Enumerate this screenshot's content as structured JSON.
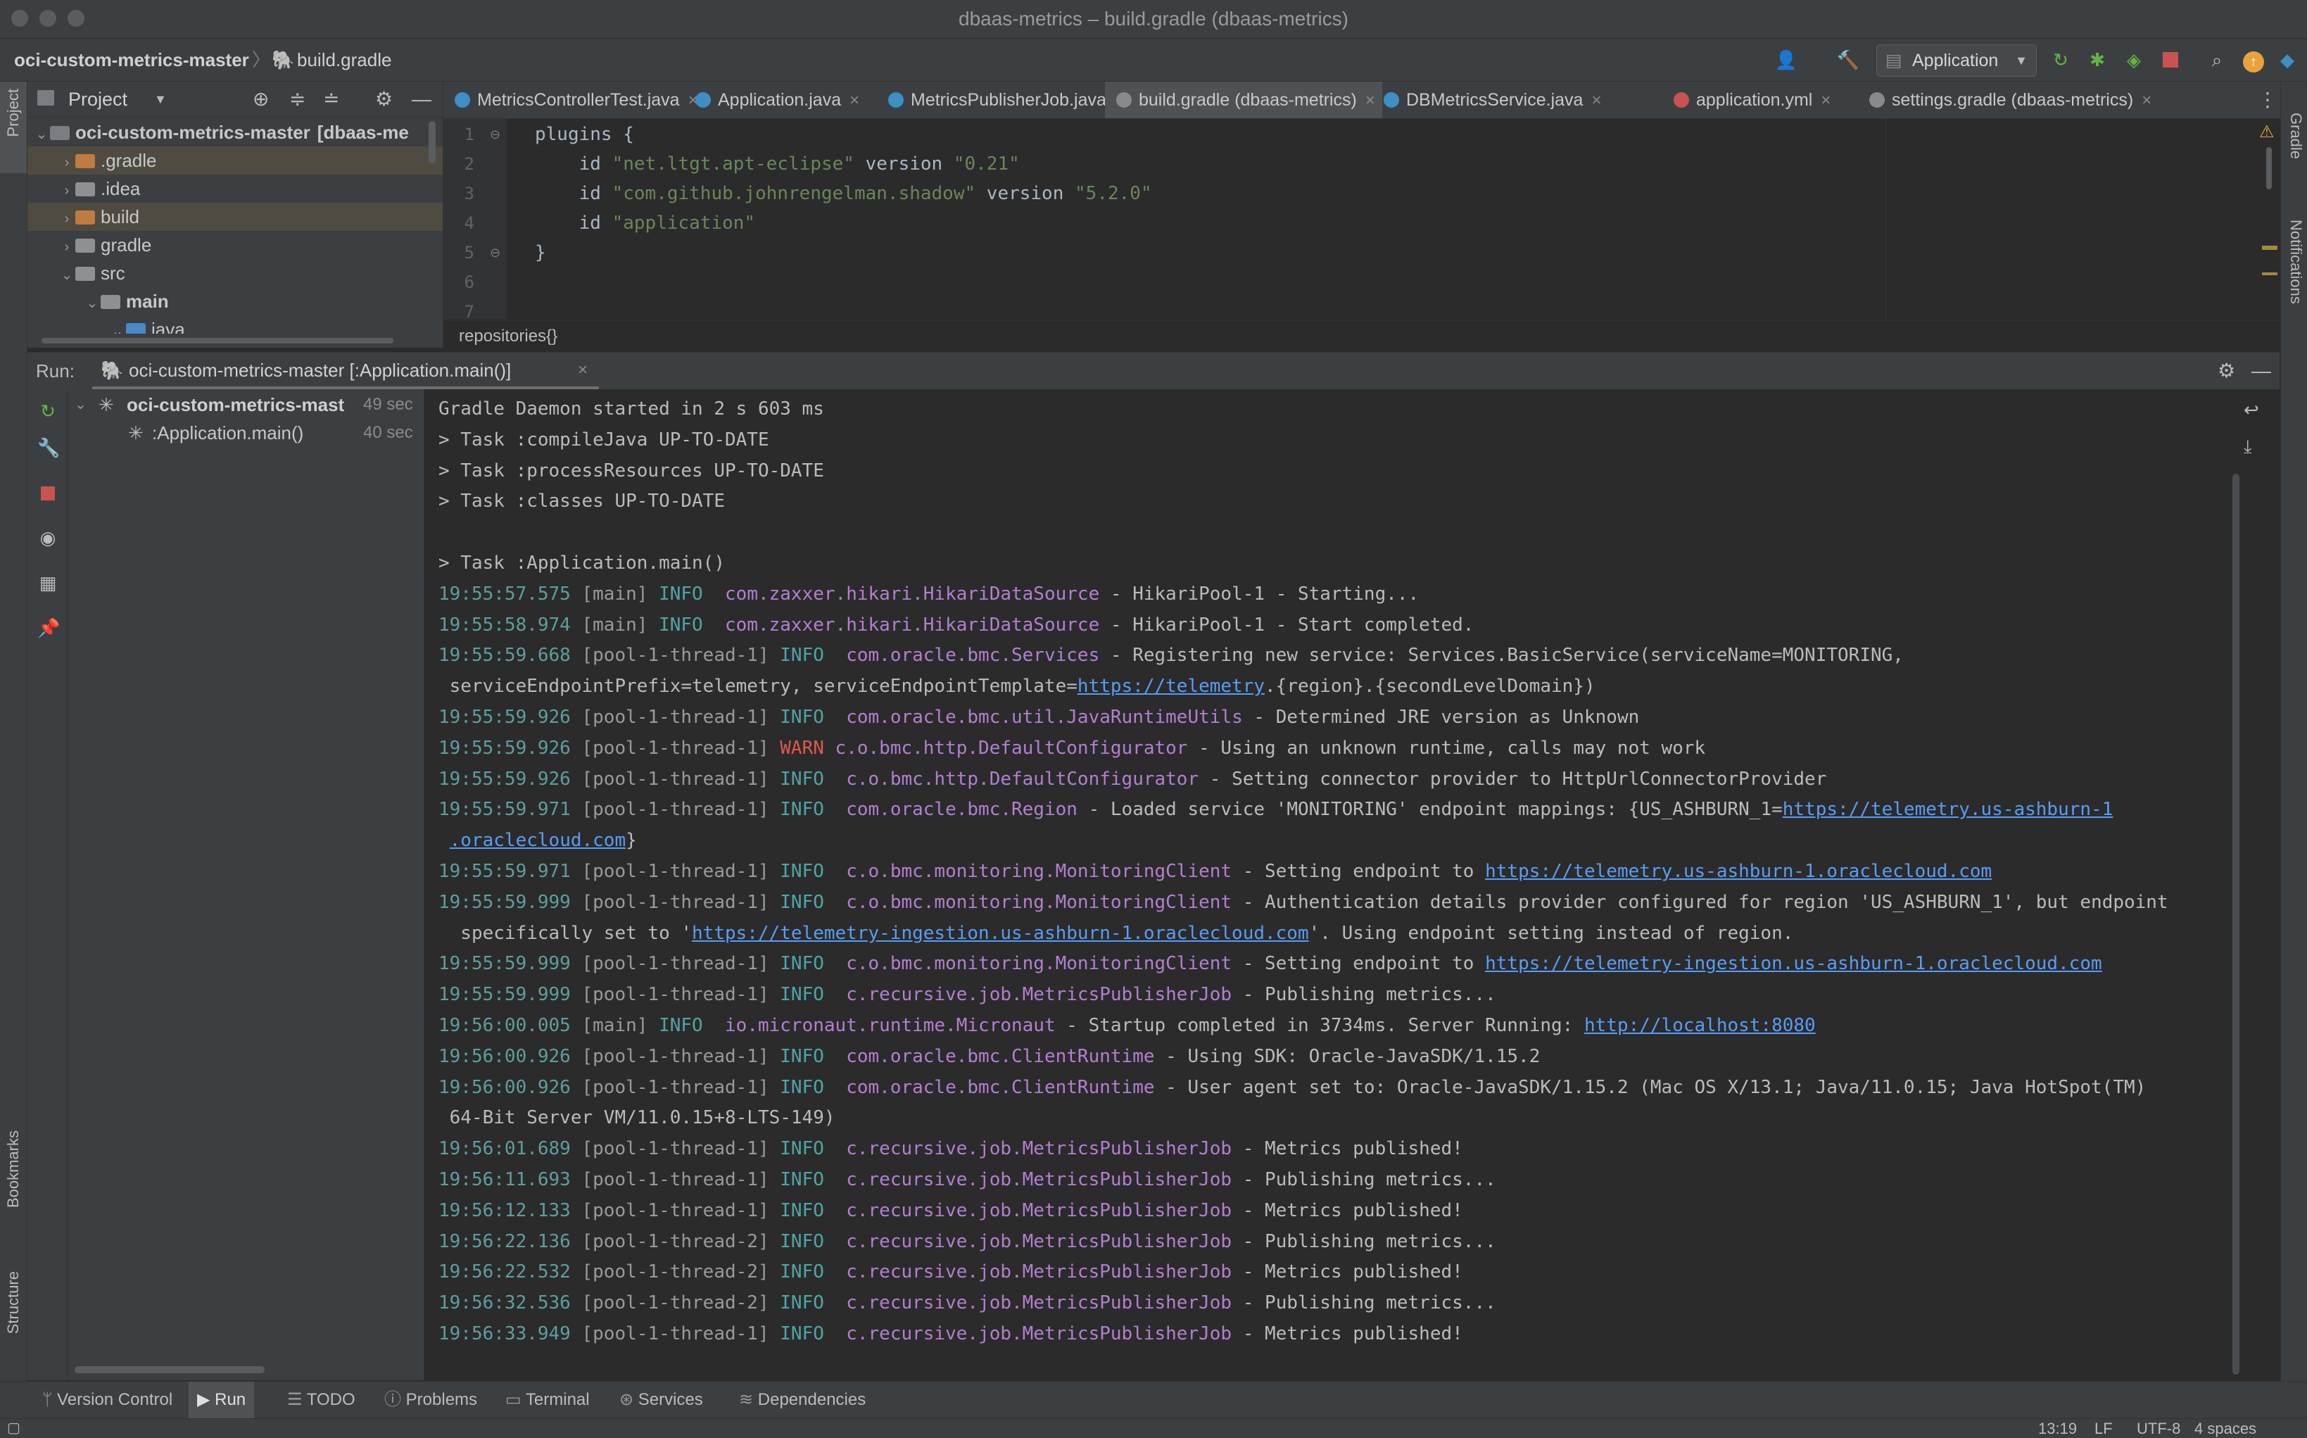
{
  "window": {
    "title": "dbaas-metrics – build.gradle (dbaas-metrics)"
  },
  "navbar": {
    "breadcrumb": [
      "oci-custom-metrics-master",
      "build.gradle"
    ],
    "run_config": "Application"
  },
  "left_stripe": {
    "project": "Project",
    "bookmarks": "Bookmarks",
    "structure": "Structure"
  },
  "right_stripe": {
    "gradle": "Gradle",
    "notifications": "Notifications"
  },
  "project_panel": {
    "title": "Project",
    "tree": [
      {
        "label": "oci-custom-metrics-master",
        "suffix": "[dbaas-me",
        "depth": 0,
        "expanded": true,
        "kind": "root"
      },
      {
        "label": ".gradle",
        "depth": 1,
        "expanded": false,
        "kind": "excluded"
      },
      {
        "label": ".idea",
        "depth": 1,
        "expanded": false,
        "kind": "folder"
      },
      {
        "label": "build",
        "depth": 1,
        "expanded": false,
        "kind": "excluded"
      },
      {
        "label": "gradle",
        "depth": 1,
        "expanded": false,
        "kind": "folder"
      },
      {
        "label": "src",
        "depth": 1,
        "expanded": true,
        "kind": "folder"
      },
      {
        "label": "main",
        "depth": 2,
        "expanded": true,
        "kind": "folder"
      },
      {
        "label": "java",
        "depth": 3,
        "expanded": true,
        "kind": "source"
      }
    ]
  },
  "editor": {
    "tabs": [
      {
        "label": "MetricsControllerTest.java",
        "active": false
      },
      {
        "label": "Application.java",
        "active": false
      },
      {
        "label": "MetricsPublisherJob.java",
        "active": false
      },
      {
        "label": "build.gradle (dbaas-metrics)",
        "active": true
      },
      {
        "label": "DBMetricsService.java",
        "active": false
      },
      {
        "label": "application.yml",
        "active": false
      },
      {
        "label": "settings.gradle (dbaas-metrics)",
        "active": false
      }
    ],
    "line_numbers": [
      "1",
      "2",
      "3",
      "4",
      "5",
      "6",
      "7"
    ],
    "lines": [
      {
        "pre": "plugins {",
        "str": "",
        "mid": "",
        "str2": ""
      },
      {
        "pre": "    id ",
        "str": "\"net.ltgt.apt-eclipse\"",
        "mid": " version ",
        "str2": "\"0.21\""
      },
      {
        "pre": "    id ",
        "str": "\"com.github.johnrengelman.shadow\"",
        "mid": " version ",
        "str2": "\"5.2.0\""
      },
      {
        "pre": "    id ",
        "str": "\"application\"",
        "mid": "",
        "str2": ""
      },
      {
        "pre": "}",
        "str": "",
        "mid": "",
        "str2": ""
      },
      {
        "pre": "",
        "str": "",
        "mid": "",
        "str2": ""
      }
    ],
    "breadcrumb": "repositories{}"
  },
  "run": {
    "label": "Run:",
    "tab": "oci-custom-metrics-master [:Application.main()]",
    "tree": [
      {
        "label": "oci-custom-metrics-mast",
        "time": "49 sec"
      },
      {
        "label": ":Application.main()",
        "time": "40 sec"
      }
    ],
    "console": [
      {
        "text": "Gradle Daemon started in 2 s 603 ms"
      },
      {
        "text": "> Task :compileJava UP-TO-DATE"
      },
      {
        "text": "> Task :processResources UP-TO-DATE"
      },
      {
        "text": "> Task :classes UP-TO-DATE"
      },
      {
        "text": ""
      },
      {
        "text": "> Task :Application.main()"
      },
      {
        "ts": "19:55:57.575",
        "thread": "[main]",
        "level": "INFO",
        "logger": "com.zaxxer.hikari.HikariDataSource",
        "msg": " - HikariPool-1 - Starting..."
      },
      {
        "ts": "19:55:58.974",
        "thread": "[main]",
        "level": "INFO",
        "logger": "com.zaxxer.hikari.HikariDataSource",
        "msg": " - HikariPool-1 - Start completed."
      },
      {
        "ts": "19:55:59.668",
        "thread": "[pool-1-thread-1]",
        "level": "INFO",
        "logger": "com.oracle.bmc.Services",
        "msg": " - Registering new service: Services.BasicService(serviceName=MONITORING,"
      },
      {
        "text": " serviceEndpointPrefix=telemetry, serviceEndpointTemplate=",
        "link": "https://telemetry",
        "after": ".{region}.{secondLevelDomain})"
      },
      {
        "ts": "19:55:59.926",
        "thread": "[pool-1-thread-1]",
        "level": "INFO",
        "logger": "com.oracle.bmc.util.JavaRuntimeUtils",
        "msg": " - Determined JRE version as Unknown"
      },
      {
        "ts": "19:55:59.926",
        "thread": "[pool-1-thread-1]",
        "level": "WARN",
        "logger": "c.o.bmc.http.DefaultConfigurator",
        "msg": " - Using an unknown runtime, calls may not work"
      },
      {
        "ts": "19:55:59.926",
        "thread": "[pool-1-thread-1]",
        "level": "INFO",
        "logger": "c.o.bmc.http.DefaultConfigurator",
        "msg": " - Setting connector provider to HttpUrlConnectorProvider"
      },
      {
        "ts": "19:55:59.971",
        "thread": "[pool-1-thread-1]",
        "level": "INFO",
        "logger": "com.oracle.bmc.Region",
        "msg": " - Loaded service 'MONITORING' endpoint mappings: {US_ASHBURN_1=",
        "link": "https://telemetry.us-ashburn-1"
      },
      {
        "text": " ",
        "link": ".oraclecloud.com",
        "after": "}"
      },
      {
        "ts": "19:55:59.971",
        "thread": "[pool-1-thread-1]",
        "level": "INFO",
        "logger": "c.o.bmc.monitoring.MonitoringClient",
        "msg": " - Setting endpoint to ",
        "link": "https://telemetry.us-ashburn-1.oraclecloud.com"
      },
      {
        "ts": "19:55:59.999",
        "thread": "[pool-1-thread-1]",
        "level": "INFO",
        "logger": "c.o.bmc.monitoring.MonitoringClient",
        "msg": " - Authentication details provider configured for region 'US_ASHBURN_1', but endpoint"
      },
      {
        "text": "  specifically set to '",
        "link": "https://telemetry-ingestion.us-ashburn-1.oraclecloud.com",
        "after": "'. Using endpoint setting instead of region."
      },
      {
        "ts": "19:55:59.999",
        "thread": "[pool-1-thread-1]",
        "level": "INFO",
        "logger": "c.o.bmc.monitoring.MonitoringClient",
        "msg": " - Setting endpoint to ",
        "link": "https://telemetry-ingestion.us-ashburn-1.oraclecloud.com"
      },
      {
        "ts": "19:55:59.999",
        "thread": "[pool-1-thread-1]",
        "level": "INFO",
        "logger": "c.recursive.job.MetricsPublisherJob",
        "msg": " - Publishing metrics..."
      },
      {
        "ts": "19:56:00.005",
        "thread": "[main]",
        "level": "INFO",
        "logger": "io.micronaut.runtime.Micronaut",
        "msg": " - Startup completed in 3734ms. Server Running: ",
        "link": "http://localhost:8080"
      },
      {
        "ts": "19:56:00.926",
        "thread": "[pool-1-thread-1]",
        "level": "INFO",
        "logger": "com.oracle.bmc.ClientRuntime",
        "msg": " - Using SDK: Oracle-JavaSDK/1.15.2"
      },
      {
        "ts": "19:56:00.926",
        "thread": "[pool-1-thread-1]",
        "level": "INFO",
        "logger": "com.oracle.bmc.ClientRuntime",
        "msg": " - User agent set to: Oracle-JavaSDK/1.15.2 (Mac OS X/13.1; Java/11.0.15; Java HotSpot(TM)"
      },
      {
        "text": " 64-Bit Server VM/11.0.15+8-LTS-149)"
      },
      {
        "ts": "19:56:01.689",
        "thread": "[pool-1-thread-1]",
        "level": "INFO",
        "logger": "c.recursive.job.MetricsPublisherJob",
        "msg": " - Metrics published!"
      },
      {
        "ts": "19:56:11.693",
        "thread": "[pool-1-thread-1]",
        "level": "INFO",
        "logger": "c.recursive.job.MetricsPublisherJob",
        "msg": " - Publishing metrics..."
      },
      {
        "ts": "19:56:12.133",
        "thread": "[pool-1-thread-1]",
        "level": "INFO",
        "logger": "c.recursive.job.MetricsPublisherJob",
        "msg": " - Metrics published!"
      },
      {
        "ts": "19:56:22.136",
        "thread": "[pool-1-thread-2]",
        "level": "INFO",
        "logger": "c.recursive.job.MetricsPublisherJob",
        "msg": " - Publishing metrics..."
      },
      {
        "ts": "19:56:22.532",
        "thread": "[pool-1-thread-2]",
        "level": "INFO",
        "logger": "c.recursive.job.MetricsPublisherJob",
        "msg": " - Metrics published!"
      },
      {
        "ts": "19:56:32.536",
        "thread": "[pool-1-thread-2]",
        "level": "INFO",
        "logger": "c.recursive.job.MetricsPublisherJob",
        "msg": " - Publishing metrics..."
      },
      {
        "ts": "19:56:33.949",
        "thread": "[pool-1-thread-1]",
        "level": "INFO",
        "logger": "c.recursive.job.MetricsPublisherJob",
        "msg": " - Metrics published!"
      }
    ]
  },
  "bottom_tools": [
    "Version Control",
    "Run",
    "TODO",
    "Problems",
    "Terminal",
    "Services",
    "Dependencies"
  ],
  "bottom_icons": [
    "branch-icon",
    "play-icon",
    "list-icon",
    "info-icon",
    "terminal-icon",
    "services-icon",
    "layers-icon"
  ],
  "status": {
    "position": "13:19",
    "line_sep": "LF",
    "encoding": "UTF-8",
    "indent": "4 spaces"
  },
  "colors": {
    "accent": "#4a88c7",
    "background": "#2b2b2b",
    "panel": "#3c3f41",
    "warn": "#e0584b",
    "info": "#4fa5a8",
    "logger": "#b37fd1",
    "link": "#589df6"
  }
}
